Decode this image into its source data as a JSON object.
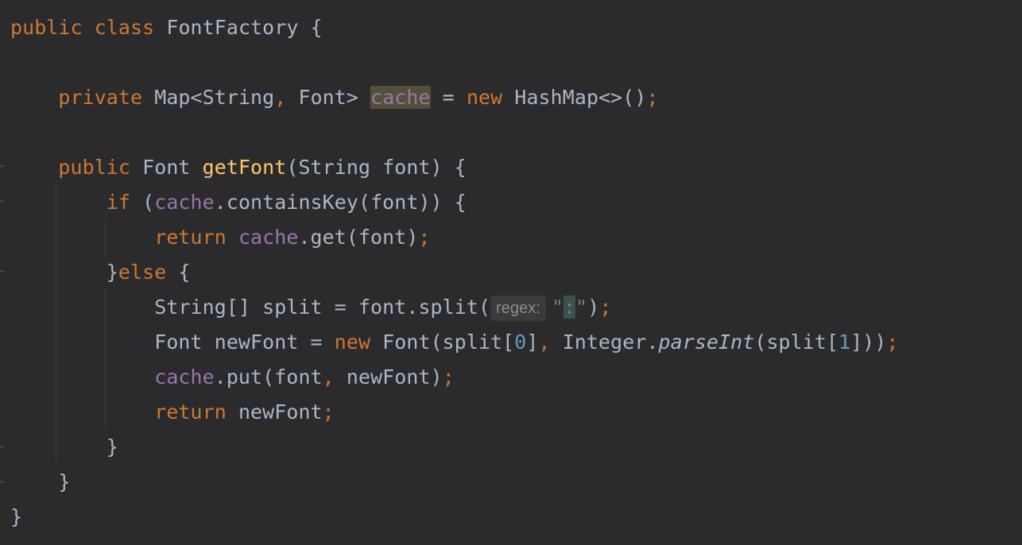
{
  "code": {
    "l1": {
      "kw1": "public",
      "kw2": "class",
      "name": "FontFactory",
      "brace": "{"
    },
    "l3": {
      "kw1": "private",
      "t1": "Map<String",
      "comma": ",",
      "t2": "Font>",
      "field": "cache",
      "eq": "=",
      "kw2": "new",
      "t3": "HashMap<>()",
      "semi": ";"
    },
    "l5": {
      "kw1": "public",
      "type": "Font",
      "method": "getFont",
      "params": "(String font) {"
    },
    "l6": {
      "kw": "if",
      "p1": "(",
      "field": "cache",
      "rest": ".containsKey(font)) {"
    },
    "l7": {
      "kw": "return",
      "field": "cache",
      "rest": ".get(font)",
      "semi": ";"
    },
    "l8": {
      "brace": "}",
      "kw": "else",
      "rest": "{"
    },
    "l9": {
      "decl": "String[] split = font.split(",
      "hint": "regex:",
      "q1": "\"",
      "colon": ":",
      "q2": "\"",
      "close": ")",
      "semi": ";"
    },
    "l10": {
      "decl": "Font newFont = ",
      "kw": "new",
      "c1": "Font(split[",
      "n1": "0",
      "c2": "]",
      "comma": ",",
      "c3": "Integer.",
      "call": "parseInt",
      "c4": "(split[",
      "n2": "1",
      "c5": "]))",
      "semi": ";"
    },
    "l11": {
      "field": "cache",
      "c1": ".put(font",
      "comma": ",",
      "c2": "newFont)",
      "semi": ";"
    },
    "l12": {
      "kw": "return",
      "c1": "newFont",
      "semi": ";"
    },
    "l13": {
      "brace": "}"
    },
    "l14": {
      "brace": "}"
    },
    "l15": {
      "brace": "}"
    }
  },
  "colors": {
    "background": "#2b2b2d",
    "keyword": "#cc7832",
    "text": "#a9b7c6",
    "field": "#9876aa",
    "method": "#ffc66d",
    "number": "#6897bb",
    "string": "#6a8759"
  },
  "gutter": {
    "fold_icon": "fold-marker-icon"
  }
}
